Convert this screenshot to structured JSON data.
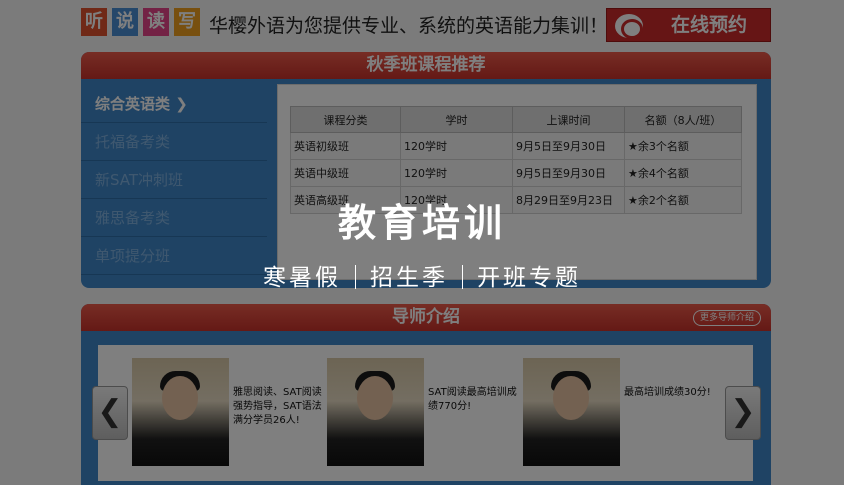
{
  "banner": {
    "tiles": [
      {
        "char": "听",
        "color": "#e0532f"
      },
      {
        "char": "说",
        "color": "#4a8fd4"
      },
      {
        "char": "读",
        "color": "#e6458b"
      },
      {
        "char": "写",
        "color": "#f0a020"
      }
    ],
    "slogan": "华樱外语为您提供专业、系统的英语能力集训！",
    "book_button": "在线预约"
  },
  "course_panel": {
    "title": "秋季班课程推荐",
    "sidebar": [
      {
        "label": "综合英语类 ❯"
      },
      {
        "label": "托福备考类"
      },
      {
        "label": "新SAT冲刺班"
      },
      {
        "label": "雅思备考类"
      },
      {
        "label": "单项提分班"
      }
    ],
    "table": {
      "headers": [
        "课程分类",
        "学时",
        "上课时间",
        "名额（8人/班）"
      ],
      "rows": [
        [
          "英语初级班",
          "120学时",
          "9月5日至9月30日",
          "★余3个名额"
        ],
        [
          "英语中级班",
          "120学时",
          "9月5日至9月30日",
          "★余4个名额"
        ],
        [
          "英语高级班",
          "120学时",
          "8月29日至9月23日",
          "★余2个名额"
        ]
      ]
    }
  },
  "teacher_panel": {
    "title": "导师介绍",
    "more_button": "更多导师介绍",
    "teachers": [
      {
        "text": "雅思阅读、SAT阅读强势指导，SAT语法满分学员26人!"
      },
      {
        "text": "SAT阅读最高培训成绩770分!"
      },
      {
        "text": "最高培训成绩30分!"
      }
    ],
    "prev_arrow": "❮",
    "next_arrow": "❯"
  },
  "overlay": {
    "title": "教育培训",
    "subtitle_parts": [
      "寒暑假",
      "招生季",
      "开班专题"
    ]
  }
}
